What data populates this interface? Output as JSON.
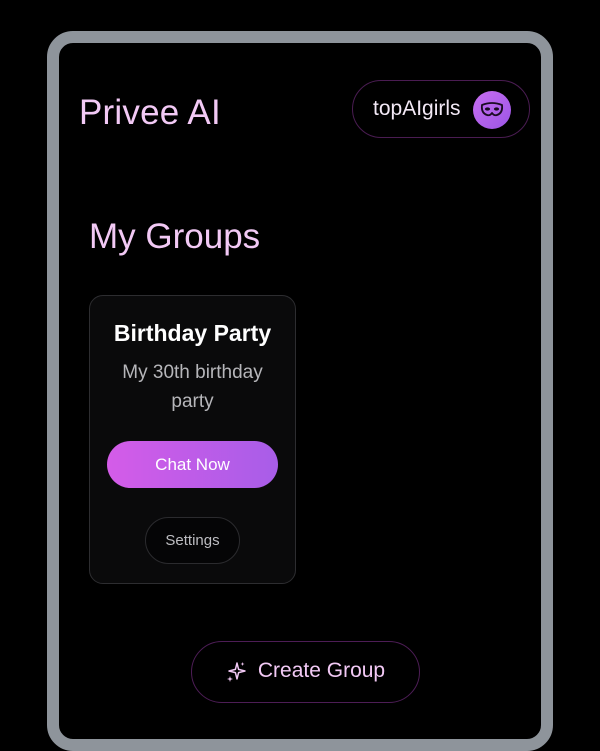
{
  "app": {
    "title": "Privee AI"
  },
  "user": {
    "name": "topAIgirls",
    "avatar_icon": "mask-icon",
    "avatar_color": "#b763ec"
  },
  "groups_section": {
    "title": "My Groups"
  },
  "groups": [
    {
      "name": "Birthday Party",
      "description": "My 30th birthday party",
      "chat_label": "Chat Now",
      "settings_label": "Settings"
    }
  ],
  "create_group": {
    "label": "Create Group",
    "icon": "sparkle-icon"
  },
  "colors": {
    "accent_text": "#f2c9f5",
    "button_gradient_start": "#d45ce8",
    "button_gradient_end": "#a85de8",
    "background": "#000000",
    "device_frame": "#8e949b"
  }
}
